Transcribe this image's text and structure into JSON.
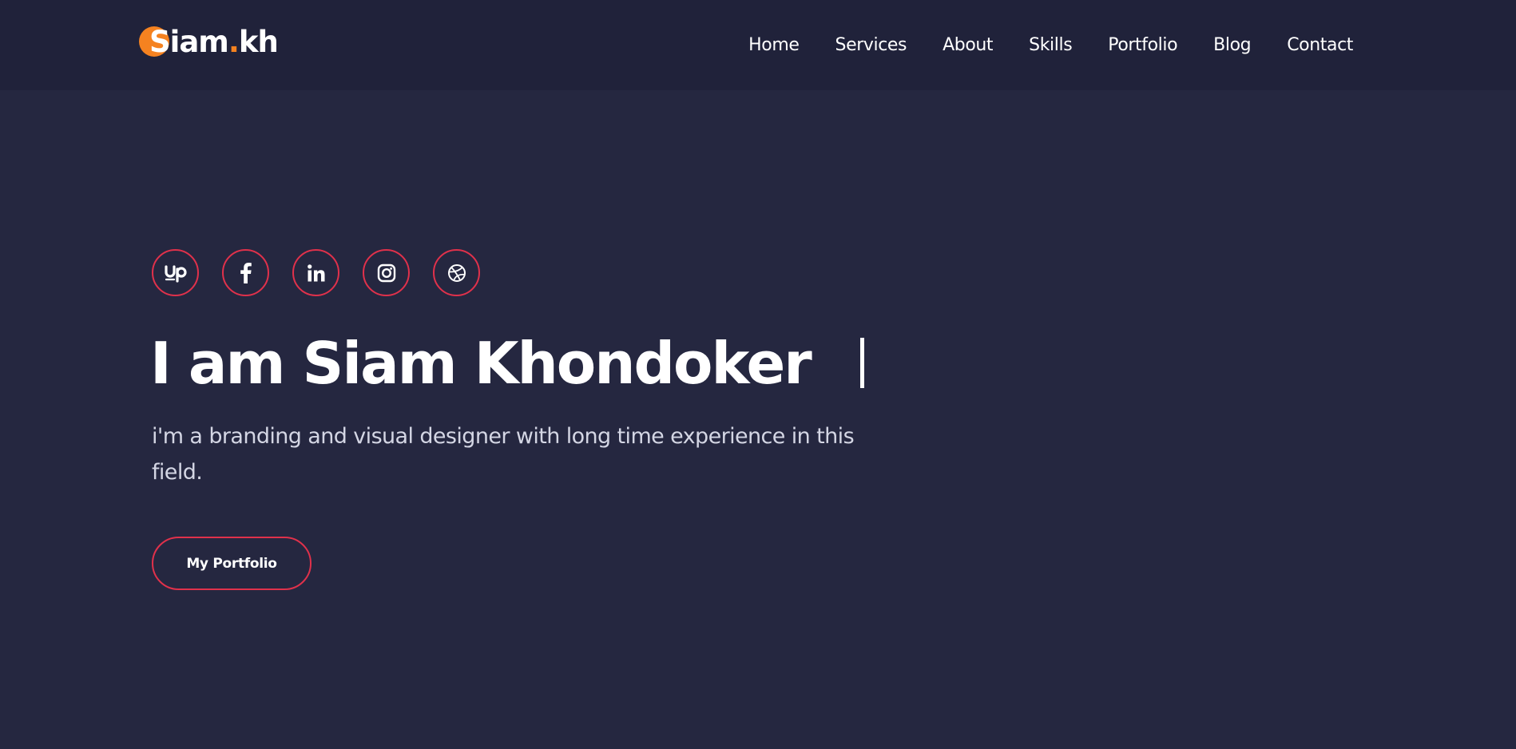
{
  "brand": {
    "name_main": "Siam",
    "name_dot": ".",
    "name_suffix": "kh",
    "accent_color": "#f58220"
  },
  "nav": {
    "items": [
      {
        "label": "Home"
      },
      {
        "label": "Services"
      },
      {
        "label": "About"
      },
      {
        "label": "Skills"
      },
      {
        "label": "Portfolio"
      },
      {
        "label": "Blog"
      },
      {
        "label": "Contact"
      }
    ]
  },
  "hero": {
    "socials": [
      {
        "icon": "upwork-icon"
      },
      {
        "icon": "facebook-icon"
      },
      {
        "icon": "linkedin-icon"
      },
      {
        "icon": "instagram-icon"
      },
      {
        "icon": "dribbble-icon"
      }
    ],
    "title": "I am Siam Khondoker",
    "description": "i'm a branding and visual designer with long time experience in this field.",
    "cta_label": "My Portfolio",
    "border_color": "#e0314b"
  },
  "colors": {
    "background": "#252740",
    "header_background": "#20223a",
    "text": "#ffffff"
  }
}
